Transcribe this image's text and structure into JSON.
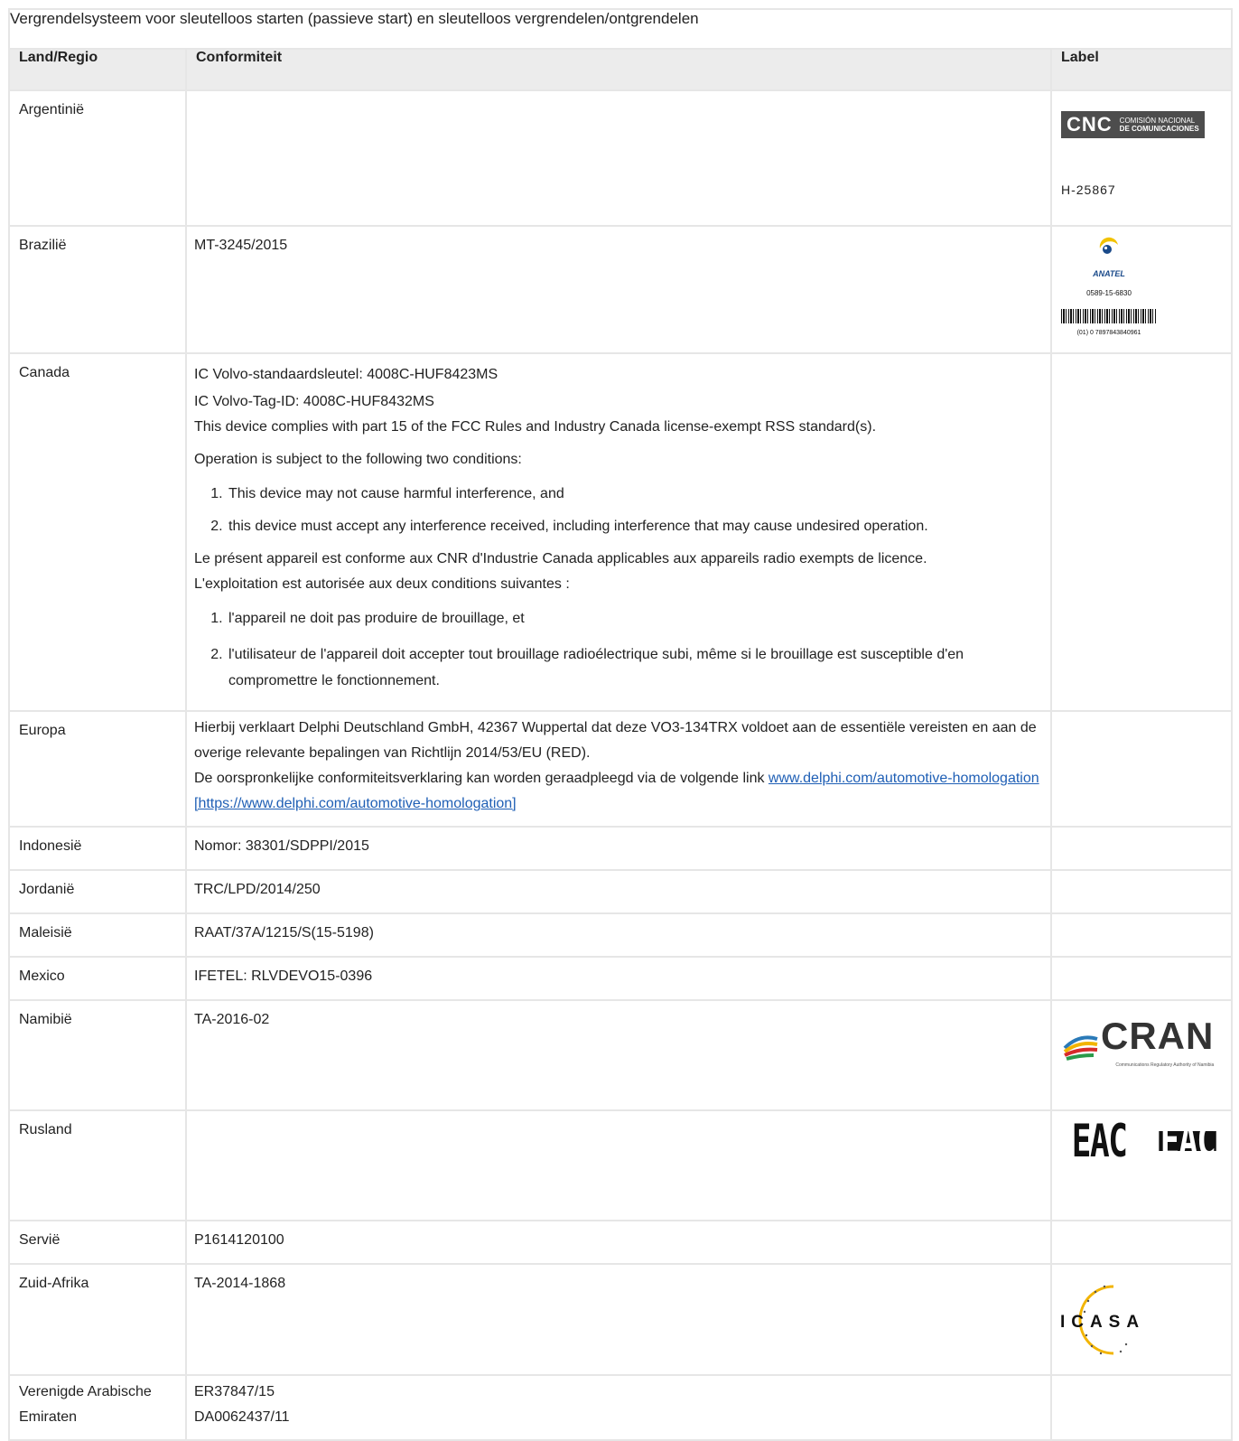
{
  "table": {
    "title": "Vergrendelsysteem voor sleutelloos starten (passieve start) en sleutelloos vergrendelen/ontgrendelen",
    "headers": [
      "Land/Regio",
      "Conformiteit",
      "Label"
    ],
    "rows": {
      "argentinie": {
        "country": "Argentinië",
        "label_text": "H-25867",
        "logo": "cnc-logo",
        "logo_big": "CNC",
        "logo_small_1": "COMISIÓN NACIONAL",
        "logo_small_2": "DE COMUNICACIONES"
      },
      "brazilie": {
        "country": "Brazilië",
        "conformity": "MT-3245/2015",
        "logo": "anatel-logo",
        "logo_word": "ANATEL",
        "logo_num": "0589-15-6830",
        "barcode_text": "(01) 0 7897843840961"
      },
      "canada": {
        "country": "Canada",
        "line1": "IC Volvo-standaardsleutel: 4008C-HUF8423MS",
        "line2": "IC Volvo-Tag-ID: 4008C-HUF8432MS",
        "line3": "This device complies with part 15 of the FCC Rules and Industry Canada license-exempt RSS standard(s).",
        "line4": "Operation is subject to the following two conditions:",
        "list1": [
          "This device may not cause harmful interference, and",
          "this device must accept any interference received, including interference that may cause undesired operation."
        ],
        "line5": "Le présent appareil est conforme aux CNR d'Industrie Canada applicables aux appareils radio exempts de licence.",
        "line6": "L'exploitation est autorisée aux deux conditions suivantes :",
        "list2": [
          "l'appareil ne doit pas produire de brouillage, et",
          "l'utilisateur de l'appareil doit accepter tout brouillage radioélectrique subi, même si le brouillage est susceptible d'en compromettre le fonctionnement."
        ]
      },
      "europa": {
        "country": "Europa",
        "text1": "Hierbij verklaart Delphi Deutschland GmbH, 42367 Wuppertal dat deze VO3-134TRX voldoet aan de essentiële vereisten en aan de overige relevante bepalingen van Richtlijn 2014/53/EU (RED).",
        "text2": "De oorspronkelijke conformiteitsverklaring kan worden geraadpleegd via de volgende link ",
        "link": "www.delphi.com/automotive-homologation [https://www.delphi.com/automotive-homologation]"
      },
      "indonesie": {
        "country": "Indonesië",
        "conformity": "Nomor: 38301/SDPPI/2015"
      },
      "jordanie": {
        "country": "Jordanië",
        "conformity": "TRC/LPD/2014/250"
      },
      "maleisie": {
        "country": "Maleisië",
        "conformity": "RAAT/37A/1215/S(15-5198)"
      },
      "mexico": {
        "country": "Mexico",
        "conformity": "IFETEL: RLVDEVO15-0396"
      },
      "namibie": {
        "country": "Namibië",
        "conformity": "TA-2016-02",
        "logo": "cran-logo",
        "logo_word": "CRAN",
        "logo_sub": "Communications Regulatory Authority of Namibia"
      },
      "rusland": {
        "country": "Rusland",
        "logo": "eac-logo",
        "logo_word": "EAC"
      },
      "servie": {
        "country": "Servië",
        "conformity": "P1614120100"
      },
      "zuidafrika": {
        "country": "Zuid-Afrika",
        "conformity": "TA-2014-1868",
        "logo": "icasa-logo",
        "logo_word": "ICASA"
      },
      "vae": {
        "country": "Verenigde Arabische Emiraten",
        "conformity_1": "ER37847/15",
        "conformity_2": "DA0062437/11"
      }
    }
  }
}
